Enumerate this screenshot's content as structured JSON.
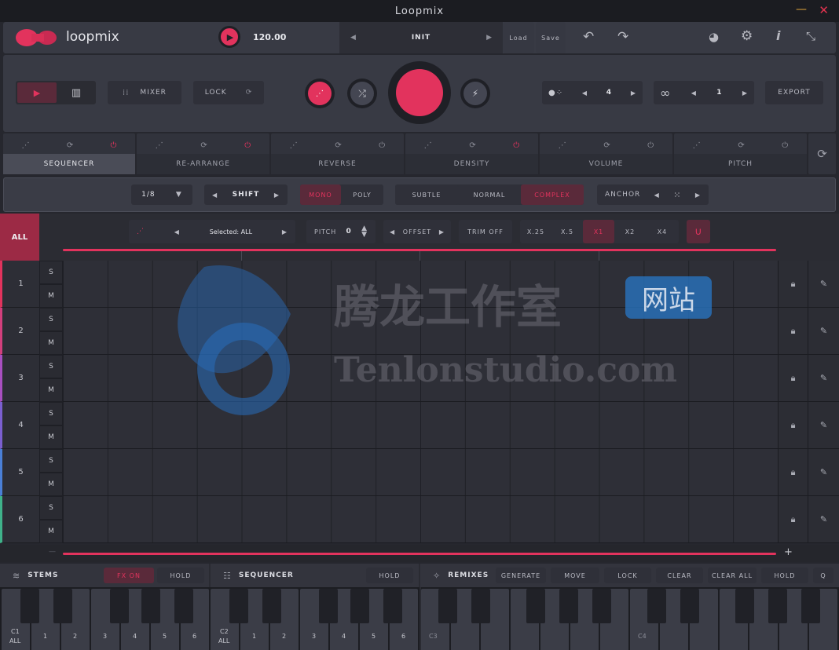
{
  "window": {
    "title": "Loopmix"
  },
  "header": {
    "logo_text": "loopmix",
    "tempo": "120.00",
    "preset": "INIT",
    "load_label": "Load",
    "save_label": "Save"
  },
  "transport": {
    "mixer_label": "MIXER",
    "lock_label": "LOCK",
    "count_value": "4",
    "loop_value": "1",
    "export_label": "EXPORT"
  },
  "tabs": [
    {
      "label": "SEQUENCER",
      "active": true
    },
    {
      "label": "RE-ARRANGE"
    },
    {
      "label": "REVERSE"
    },
    {
      "label": "DENSITY"
    },
    {
      "label": "VOLUME"
    },
    {
      "label": "PITCH"
    }
  ],
  "options": {
    "division": "1/8",
    "shift_label": "SHIFT",
    "mono_label": "MONO",
    "poly_label": "POLY",
    "subtle_label": "SUBTLE",
    "normal_label": "NORMAL",
    "complex_label": "COMPLEX",
    "anchor_label": "ANCHOR"
  },
  "seqbar": {
    "all_label": "ALL",
    "selected_label": "Selected: ALL",
    "pitch_label": "PITCH",
    "pitch_value": "0",
    "offset_label": "OFFSET",
    "trim_label": "TRIM OFF",
    "speeds": [
      "X.25",
      "X.5",
      "X1",
      "X2",
      "X4"
    ],
    "active_speed": "X1"
  },
  "rows": [
    {
      "num": "1",
      "color": "#e2335d"
    },
    {
      "num": "2",
      "color": "#d23f7c"
    },
    {
      "num": "3",
      "color": "#a84fc0"
    },
    {
      "num": "4",
      "color": "#7b5fd0"
    },
    {
      "num": "5",
      "color": "#4a7fd6"
    },
    {
      "num": "6",
      "color": "#3fb28a"
    }
  ],
  "sm": {
    "s": "S",
    "m": "M"
  },
  "bottom": {
    "stems_label": "STEMS",
    "fx_on_label": "FX ON",
    "hold_label": "HOLD",
    "sequencer_label": "SEQUENCER",
    "seq_hold_label": "HOLD",
    "remixes_label": "REMIXES",
    "generate_label": "GENERATE",
    "move_label": "MOVE",
    "lock_label": "LOCK",
    "clear_label": "CLEAR",
    "clear_all_label": "CLEAR ALL",
    "remix_hold_label": "HOLD",
    "q_label": "Q"
  },
  "keys": {
    "c1": "C1",
    "c2": "C2",
    "c3": "C3",
    "c4": "C4",
    "all": "ALL",
    "numbers": [
      "1",
      "2",
      "3",
      "4",
      "5",
      "6"
    ],
    "colors": [
      "#e2335d",
      "#d23f7c",
      "#a84fc0",
      "#7b5fd0",
      "#4a7fd6",
      "#3fb28a"
    ]
  },
  "watermark": {
    "cn": "腾龙工作室",
    "cn_badge": "网站",
    "en": "Tenlonstudio.com"
  }
}
